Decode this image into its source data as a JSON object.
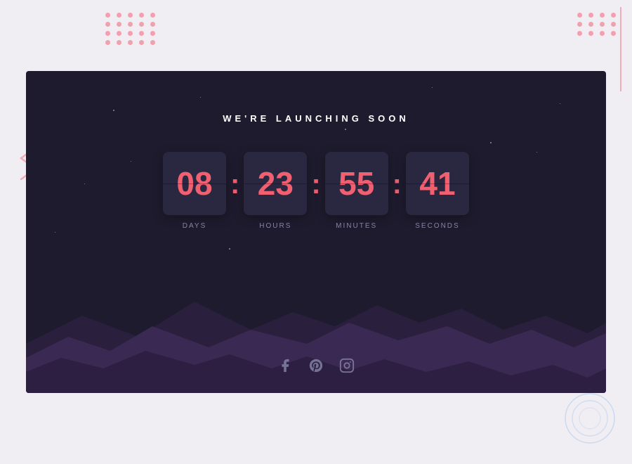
{
  "background": {
    "dots_tl_count": 20,
    "dots_tr_count": 12,
    "accent_color": "#f08090",
    "bg_color": "#f0eef2"
  },
  "card": {
    "bg_color": "#1e1b2e"
  },
  "headline": "WE'RE LAUNCHING SOON",
  "countdown": {
    "days": {
      "value": "08",
      "label": "DAYS"
    },
    "hours": {
      "value": "23",
      "label": "HOURS"
    },
    "minutes": {
      "value": "55",
      "label": "MINUTES"
    },
    "seconds": {
      "value": "41",
      "label": "SECONDS"
    }
  },
  "social": {
    "facebook_label": "Facebook",
    "pinterest_label": "Pinterest",
    "instagram_label": "Instagram"
  }
}
